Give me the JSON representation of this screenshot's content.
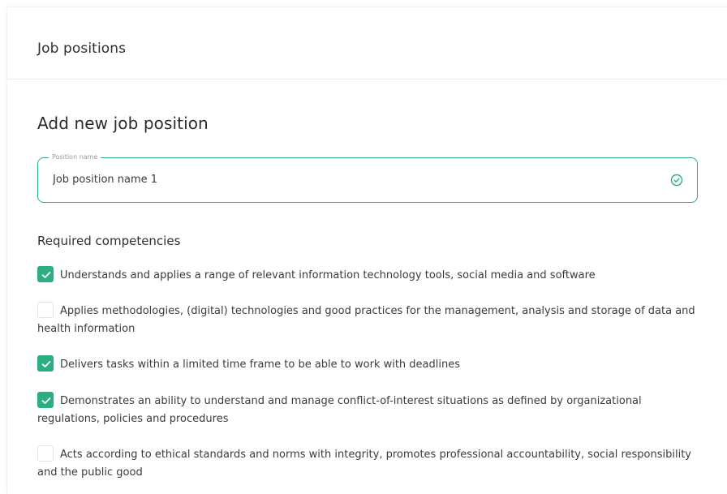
{
  "header": {
    "title": "Job positions"
  },
  "form": {
    "title": "Add new job position",
    "position_field": {
      "label": "Position name",
      "value": "Job position name 1",
      "valid_icon": "check-circle-icon"
    },
    "competencies": {
      "heading": "Required competencies",
      "items": [
        {
          "label": "Understands and applies a range of relevant information technology tools, social media and software",
          "checked": true
        },
        {
          "label": "Applies methodologies, (digital) technologies and good practices for the management, analysis and storage of data and health information",
          "checked": false
        },
        {
          "label": "Delivers tasks within a limited time frame to be able to work with deadlines",
          "checked": true
        },
        {
          "label": "Demonstrates an ability to understand and manage conflict-of-interest situations as defined by organizational regulations, policies and procedures",
          "checked": true
        },
        {
          "label": "Acts according to ethical standards and norms with integrity, promotes professional accountability, social responsibility and the public good",
          "checked": false
        }
      ]
    }
  },
  "colors": {
    "accent": "#2bae84",
    "checkbox_off_border": "#e3e3e3"
  }
}
